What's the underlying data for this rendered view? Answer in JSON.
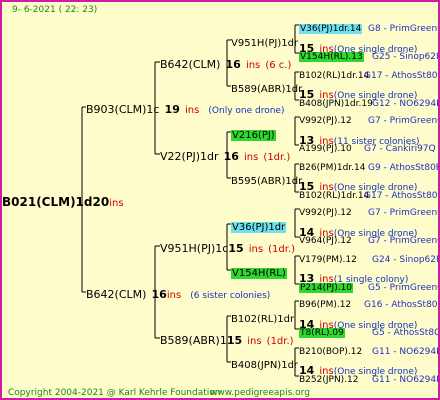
{
  "header": {
    "date": "9-  6-2021 ( 22:  23)"
  },
  "footer": {
    "copyright": "Copyright 2004-2021 @ Karl Kehrle Foundation",
    "site": "www.pedigreeapis.org"
  },
  "root": {
    "name": "B021(CLM)1d",
    "num": "20",
    "ins": "ins"
  },
  "gen1": [
    {
      "name": "B903(CLM)1c",
      "num": "19",
      "ins": "ins",
      "note": "(Only one drone)"
    },
    {
      "name": "B642(CLM)",
      "num": "16",
      "ins": "ins",
      "note": "(6 sister colonies)"
    }
  ],
  "gen2": [
    {
      "name": "B642(CLM)",
      "num": "16",
      "ins": "ins",
      "note": "(6 c.)"
    },
    {
      "name": "V22(PJ)1dr",
      "num": "16",
      "ins": "ins",
      "note": "(1dr.)"
    },
    {
      "name": "V951H(PJ)1c",
      "num": "15",
      "ins": "ins",
      "note": "(1dr.)"
    },
    {
      "name": "B589(ABR)1",
      "num": "15",
      "ins": "ins",
      "note": "(1dr.)"
    }
  ],
  "gen3": [
    {
      "name": "V951H(PJ)1dr",
      "num": "15",
      "ins": "ins",
      "note": "(One single drone)"
    },
    {
      "name": "B589(ABR)1dr",
      "num": "15",
      "ins": "ins",
      "note": "(One single drone)"
    },
    {
      "name": "V216(PJ)",
      "num": "13",
      "ins": "ins",
      "note": "(11 sister colonies)"
    },
    {
      "name": "B595(ABR)1dr",
      "num": "15",
      "ins": "ins",
      "note": "(One single drone)"
    },
    {
      "name": "V36(PJ)1dr",
      "num": "14",
      "ins": "ins",
      "note": "(One single drone)"
    },
    {
      "name": "V154H(RL)",
      "num": "13",
      "ins": "ins",
      "note": "(1 single colony)"
    },
    {
      "name": "B102(RL)1dr",
      "num": "14",
      "ins": "ins",
      "note": "(One single drone)"
    },
    {
      "name": "B408(JPN)1dr",
      "num": "14",
      "ins": "ins",
      "note": "(One single drone)"
    }
  ],
  "gen4": [
    {
      "name": "V36(PJ)1dr.14",
      "code": "G8 - PrimGreen00"
    },
    {
      "name": "V154H(RL).13",
      "code": "G25 - Sinop62R"
    },
    {
      "name": "B102(RL)1dr.14",
      "code": "G17 - AthosSt80R"
    },
    {
      "name": "B408(JPN)1dr.19",
      "code": "G12 - NO6294R"
    },
    {
      "name": "V992(PJ).12",
      "code": "G7 - PrimGreen00"
    },
    {
      "name": "A199(PJ).10",
      "code": "G7 - Cankiri97Q"
    },
    {
      "name": "B26(PM)1dr.14",
      "code": "G9 - AthosSt80R"
    },
    {
      "name": "B102(RL)1dr.14",
      "code": "G17 - AthosSt80R"
    },
    {
      "name": "V992(PJ).12",
      "code": "G7 - PrimGreen00"
    },
    {
      "name": "V964(PJ).12",
      "code": "G7 - PrimGreen00"
    },
    {
      "name": "V179(PM).12",
      "code": "G24 - Sinop62R"
    },
    {
      "name": "P214(PJ).10",
      "code": "G5 - PrimGreen00"
    },
    {
      "name": "B96(PM).12",
      "code": "G16 - AthosSt80R"
    },
    {
      "name": "T8(RL).09",
      "code": "G5 - AthosSt80R"
    },
    {
      "name": "B210(BOP).12",
      "code": "G11 - NO6294R"
    },
    {
      "name": "B252(JPN).12",
      "code": "G11 - NO6294R"
    }
  ],
  "colors": {
    "background": "#fffccc",
    "border": "#d01ca5",
    "highlight_cyan": "#6ee0f0",
    "highlight_green": "#2fd82f",
    "ins_red": "#cc0000",
    "note_blue": "#1030c0"
  }
}
